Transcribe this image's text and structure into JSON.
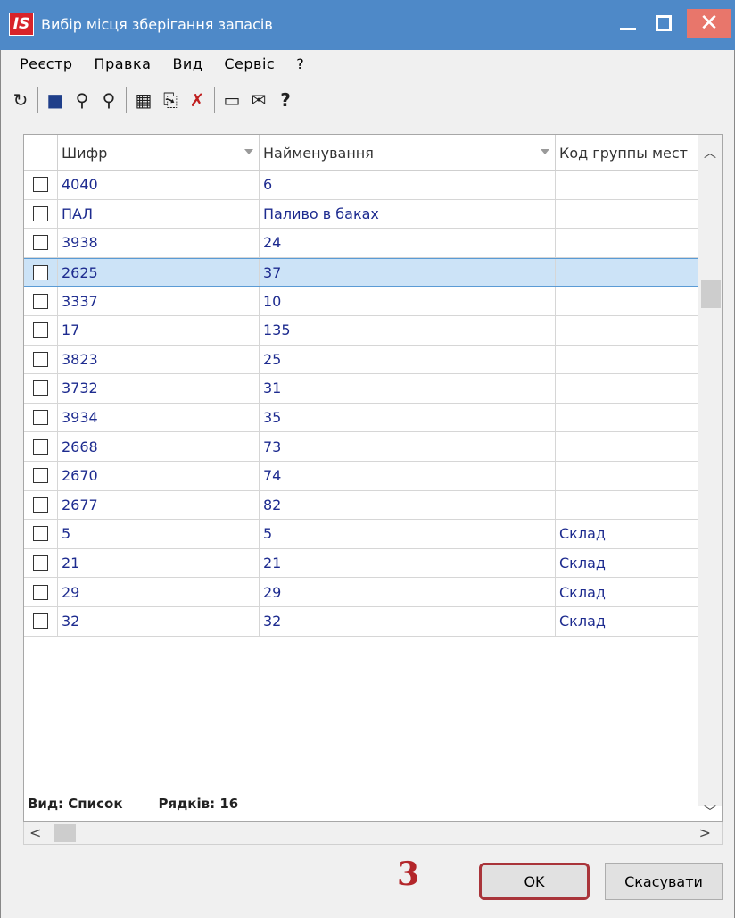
{
  "window": {
    "logo_text": "IS",
    "title": "Вибір місця зберігання запасів",
    "close_glyph": "✕"
  },
  "menu": [
    "Реєстр",
    "Правка",
    "Вид",
    "Сервіс",
    "?"
  ],
  "toolbar": {
    "icons": [
      "refresh-icon",
      "save-icon",
      "search-icon",
      "search-next-icon",
      "table-icon",
      "copy-icon",
      "filter-clear-icon",
      "form-icon",
      "mail-icon",
      "help-icon"
    ],
    "glyphs": [
      "↻",
      "■",
      "⚲",
      "⚲",
      "▦",
      "⎘",
      "✗",
      "▭",
      "✉",
      "?"
    ]
  },
  "grid": {
    "columns": [
      "Шифр",
      "Найменування",
      "Код группы мест"
    ],
    "rows": [
      {
        "code": "4040",
        "name": "6",
        "group": ""
      },
      {
        "code": "ПАЛ",
        "name": "Паливо в баках",
        "group": ""
      },
      {
        "code": "3938",
        "name": "24",
        "group": ""
      },
      {
        "code": "2625",
        "name": "37",
        "group": "",
        "selected": true
      },
      {
        "code": "3337",
        "name": "10",
        "group": ""
      },
      {
        "code": "17",
        "name": "135",
        "group": ""
      },
      {
        "code": "3823",
        "name": "25",
        "group": ""
      },
      {
        "code": "3732",
        "name": "31",
        "group": ""
      },
      {
        "code": "3934",
        "name": "35",
        "group": ""
      },
      {
        "code": "2668",
        "name": "73",
        "group": ""
      },
      {
        "code": "2670",
        "name": "74",
        "group": ""
      },
      {
        "code": "2677",
        "name": "82",
        "group": ""
      },
      {
        "code": "5",
        "name": "5",
        "group": "Склад"
      },
      {
        "code": "21",
        "name": "21",
        "group": "Склад"
      },
      {
        "code": "29",
        "name": "29",
        "group": "Склад"
      },
      {
        "code": "32",
        "name": "32",
        "group": "Склад"
      }
    ]
  },
  "status": {
    "view": "Вид: Список",
    "rows": "Рядків: 16"
  },
  "annotation": "3",
  "buttons": {
    "ok": "OK",
    "cancel": "Скасувати"
  },
  "colors": {
    "titlebar": "#4e89c8",
    "close": "#e8766b",
    "link_text": "#1d2b8f",
    "selected_row": "#cce3f7",
    "highlight": "#a9343a"
  }
}
